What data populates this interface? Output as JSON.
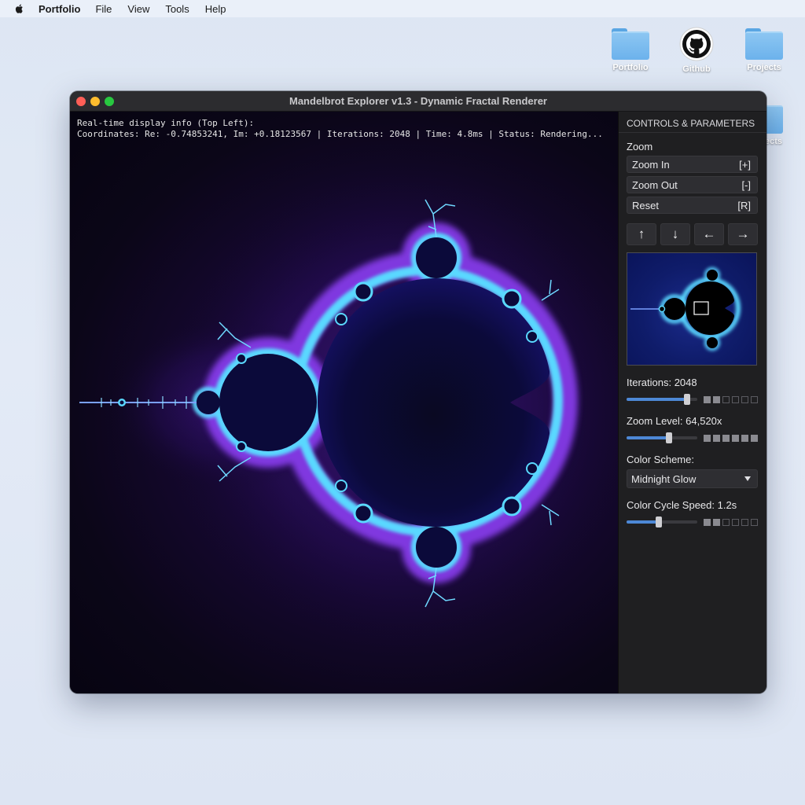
{
  "menubar": {
    "app_name": "Portfolio",
    "items": [
      "File",
      "View",
      "Tools",
      "Help"
    ]
  },
  "desktop": {
    "icons": [
      {
        "label": "Portfolio",
        "icon": "folder-icon"
      },
      {
        "label": "Github",
        "icon": "github-icon"
      },
      {
        "label": "Projects",
        "icon": "folder-icon"
      },
      {
        "label": "ects",
        "icon": "folder-icon"
      }
    ]
  },
  "window": {
    "title": "Mandelbrot Explorer v1.3 - Dynamic Fractal Renderer",
    "overlay": {
      "line1": "Real-time display info (Top Left):",
      "line2": "Coordinates: Re: -0.74853241, Im: +0.18123567 | Iterations: 2048 | Time: 4.8ms | Status: Rendering..."
    }
  },
  "panel": {
    "heading": "CONTROLS & PARAMETERS",
    "zoom_label": "Zoom",
    "buttons": [
      {
        "label": "Zoom In",
        "shortcut": "[+]"
      },
      {
        "label": "Zoom Out",
        "shortcut": "[-]"
      },
      {
        "label": "Reset",
        "shortcut": "[R]"
      }
    ],
    "arrows": [
      "↑",
      "↓",
      "←",
      "→"
    ],
    "iterations": {
      "label": "Iterations: 2048",
      "level": 0.85,
      "ticks_on": 2,
      "ticks_total": 6
    },
    "zoom_level": {
      "label": "Zoom Level: 64,520x",
      "level": 0.6,
      "ticks_on": 6,
      "ticks_total": 6
    },
    "color_scheme": {
      "label": "Color Scheme:",
      "value": "Midnight Glow"
    },
    "cycle_speed": {
      "label": "Color Cycle Speed: 1.2s",
      "level": 0.45,
      "ticks_on": 2,
      "ticks_total": 6
    }
  },
  "colors": {
    "accent": "#4d88d6",
    "glow": "#5ad8ff",
    "purple": "#8a3cf0",
    "set_fill": "#0b0a3a"
  }
}
